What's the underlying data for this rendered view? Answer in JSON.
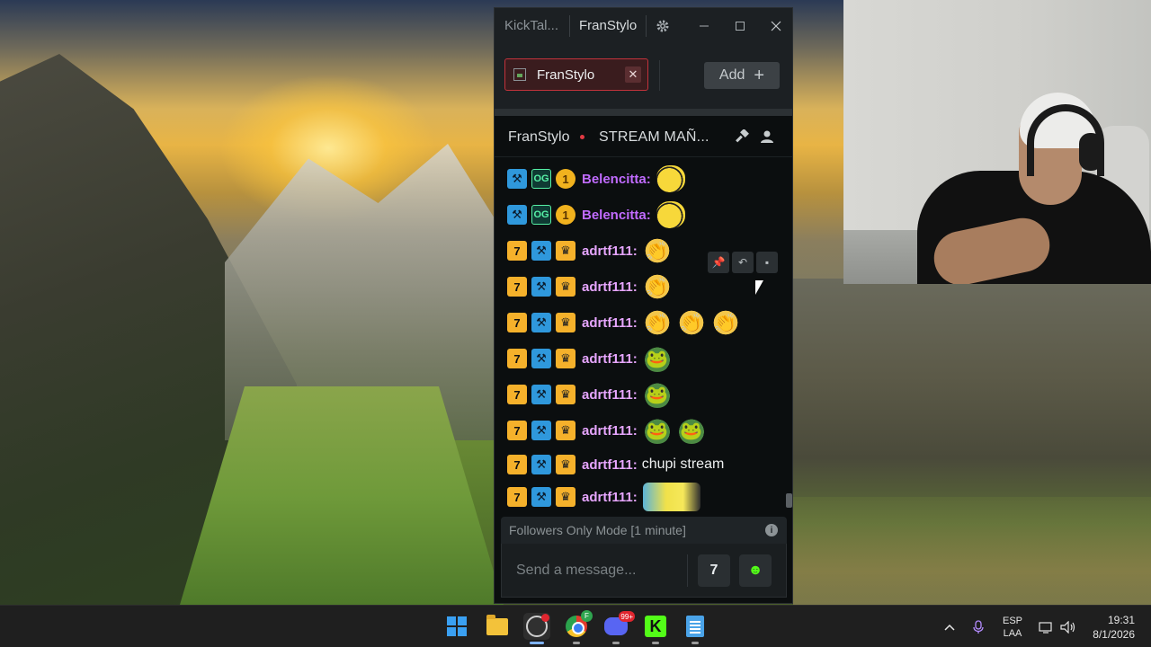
{
  "chat_app": {
    "app_name": "KickTal...",
    "window_channel": "FranStylo",
    "tab": {
      "label": "FranStylo"
    },
    "add_button": {
      "label": "Add"
    },
    "header": {
      "channel": "FranStylo",
      "stream_title": "STREAM MAÑ..."
    },
    "messages": [
      {
        "user": "Belencitta:",
        "badges": [
          "mod",
          "og",
          "sub"
        ],
        "text": "",
        "emotes": [
          "bee"
        ],
        "name_color": "#c16bff"
      },
      {
        "user": "Belencitta:",
        "badges": [
          "mod",
          "og",
          "sub"
        ],
        "text": "",
        "emotes": [
          "bee"
        ],
        "name_color": "#c16bff"
      },
      {
        "user": "adrtf111:",
        "badges": [
          "kick",
          "mod",
          "vip"
        ],
        "text": "",
        "emotes": [
          "clap"
        ],
        "name_color": "#e7a6ff"
      },
      {
        "user": "adrtf111:",
        "badges": [
          "kick",
          "mod",
          "vip"
        ],
        "text": "",
        "emotes": [
          "clap"
        ],
        "name_color": "#e7a6ff"
      },
      {
        "user": "adrtf111:",
        "badges": [
          "kick",
          "mod",
          "vip"
        ],
        "text": "",
        "emotes": [
          "clap",
          "clap",
          "clap"
        ],
        "name_color": "#e7a6ff"
      },
      {
        "user": "adrtf111:",
        "badges": [
          "kick",
          "mod",
          "vip"
        ],
        "text": "",
        "emotes": [
          "pepe"
        ],
        "name_color": "#e7a6ff"
      },
      {
        "user": "adrtf111:",
        "badges": [
          "kick",
          "mod",
          "vip"
        ],
        "text": "",
        "emotes": [
          "pepe"
        ],
        "name_color": "#e7a6ff"
      },
      {
        "user": "adrtf111:",
        "badges": [
          "kick",
          "mod",
          "vip"
        ],
        "text": "",
        "emotes": [
          "pepe",
          "pepe"
        ],
        "name_color": "#e7a6ff"
      },
      {
        "user": "adrtf111:",
        "badges": [
          "kick",
          "mod",
          "vip"
        ],
        "text": "chupi stream",
        "emotes": [],
        "name_color": "#e7a6ff"
      },
      {
        "user": "adrtf111:",
        "badges": [
          "kick",
          "mod",
          "vip"
        ],
        "text": "",
        "emotes": [
          "minion"
        ],
        "name_color": "#e7a6ff"
      }
    ],
    "followers_mode": "Followers Only Mode [1 minute]",
    "composer_placeholder": "Send a message..."
  },
  "taskbar": {
    "apps": [
      "start-icon",
      "file-explorer-icon",
      "obs-icon",
      "chrome-icon",
      "discord-icon",
      "kick-icon",
      "notepad-icon"
    ],
    "chrome_badge": "F",
    "discord_badge": "99+",
    "language": {
      "line1": "ESP",
      "line2": "LAA"
    },
    "time": "19:31",
    "date": "8/1/2026"
  },
  "colors": {
    "tab_border": "#c2323b",
    "kick_green": "#53fc18",
    "mod_badge": "#2f98dc",
    "vip_badge": "#f5b12b"
  }
}
